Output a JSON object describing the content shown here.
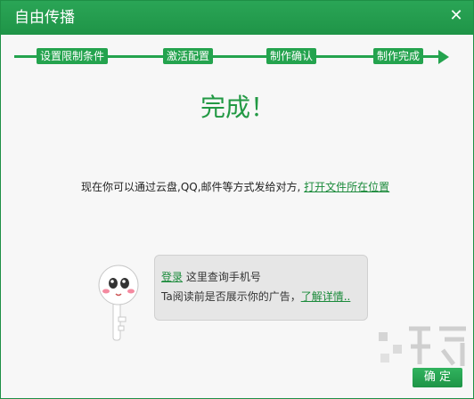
{
  "window": {
    "title": "自由传播",
    "close_symbol": "✕"
  },
  "steps": [
    "设置限制条件",
    "激活配置",
    "制作确认",
    "制作完成"
  ],
  "main": {
    "done_title": "完成！",
    "info_text": "现在你可以通过云盘,QQ,邮件等方式发给对方,",
    "open_folder_link": "打开文件所在位置"
  },
  "tip": {
    "login_link": "登录",
    "login_text": "这里查询手机号",
    "ad_text": "Ta阅读前是否展示你的广告，",
    "details_link": "了解详情.."
  },
  "buttons": {
    "ok": "确 定"
  },
  "colors": {
    "accent": "#24a34e",
    "link": "#1a8a3a"
  }
}
